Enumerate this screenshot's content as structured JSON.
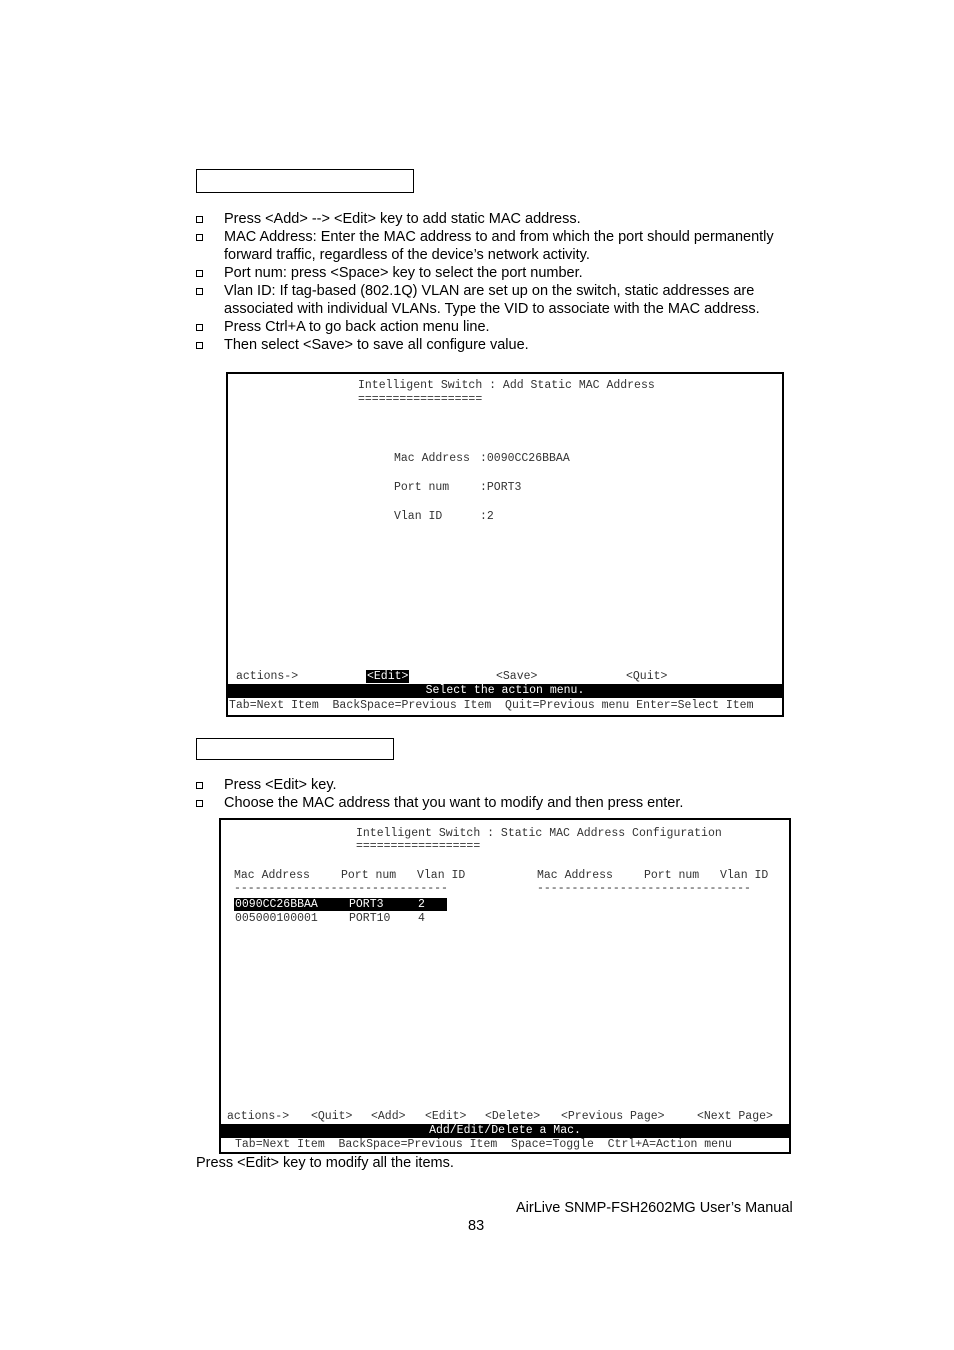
{
  "section1": {
    "bullets": [
      "Press <Add> --> <Edit> key to add static MAC address.",
      "MAC Address: Enter the MAC address to and from which the port should permanently forward traffic, regardless of the device’s network activity.",
      "Port num: press <Space> key to select the port number.",
      "Vlan ID: If tag-based (802.1Q) VLAN are set up on the switch, static addresses are associated with individual VLANs. Type the VID to associate with the MAC address.",
      "Press Ctrl+A to go back action menu line.",
      "Then select <Save> to save all configure value."
    ]
  },
  "screen1": {
    "title": "Intelligent Switch : Add Static MAC Address",
    "underline": "==================",
    "fields": [
      {
        "label": "Mac Address",
        "value": ":0090CC26BBAA"
      },
      {
        "label": "Port num",
        "value": ":PORT3"
      },
      {
        "label": "Vlan ID",
        "value": ":2"
      }
    ],
    "actions_label": "actions->",
    "actions": [
      "<Edit>",
      "<Save>",
      "<Quit>"
    ],
    "selected_action": "<Edit>",
    "status": "Select the action menu.",
    "help": "Tab=Next Item  BackSpace=Previous Item  Quit=Previous menu Enter=Select Item"
  },
  "section2": {
    "bullets": [
      "Press <Edit> key.",
      "Choose the MAC address that you want to modify and then press enter."
    ]
  },
  "screen2": {
    "title": "Intelligent Switch : Static MAC Address Configuration",
    "underline": "==================",
    "columns": [
      "Mac Address",
      "Port num",
      "Vlan ID"
    ],
    "divider": "-------------------------------",
    "rows": [
      {
        "mac": "0090CC26BBAA",
        "port": "PORT3",
        "vlan": "2",
        "selected": true
      },
      {
        "mac": "005000100001",
        "port": "PORT10",
        "vlan": "4",
        "selected": false
      }
    ],
    "actions_label": "actions->",
    "actions": [
      "<Quit>",
      "<Add>",
      "<Edit>",
      "<Delete>",
      "<Previous Page>",
      "<Next Page>"
    ],
    "status": "Add/Edit/Delete a Mac.",
    "help": "Tab=Next Item  BackSpace=Previous Item  Space=Toggle  Ctrl+A=Action menu"
  },
  "caption": "Press <Edit> key to modify all the items.",
  "footer": {
    "manual_title": "AirLive SNMP-FSH2602MG User’s Manual",
    "page_number": "83"
  }
}
